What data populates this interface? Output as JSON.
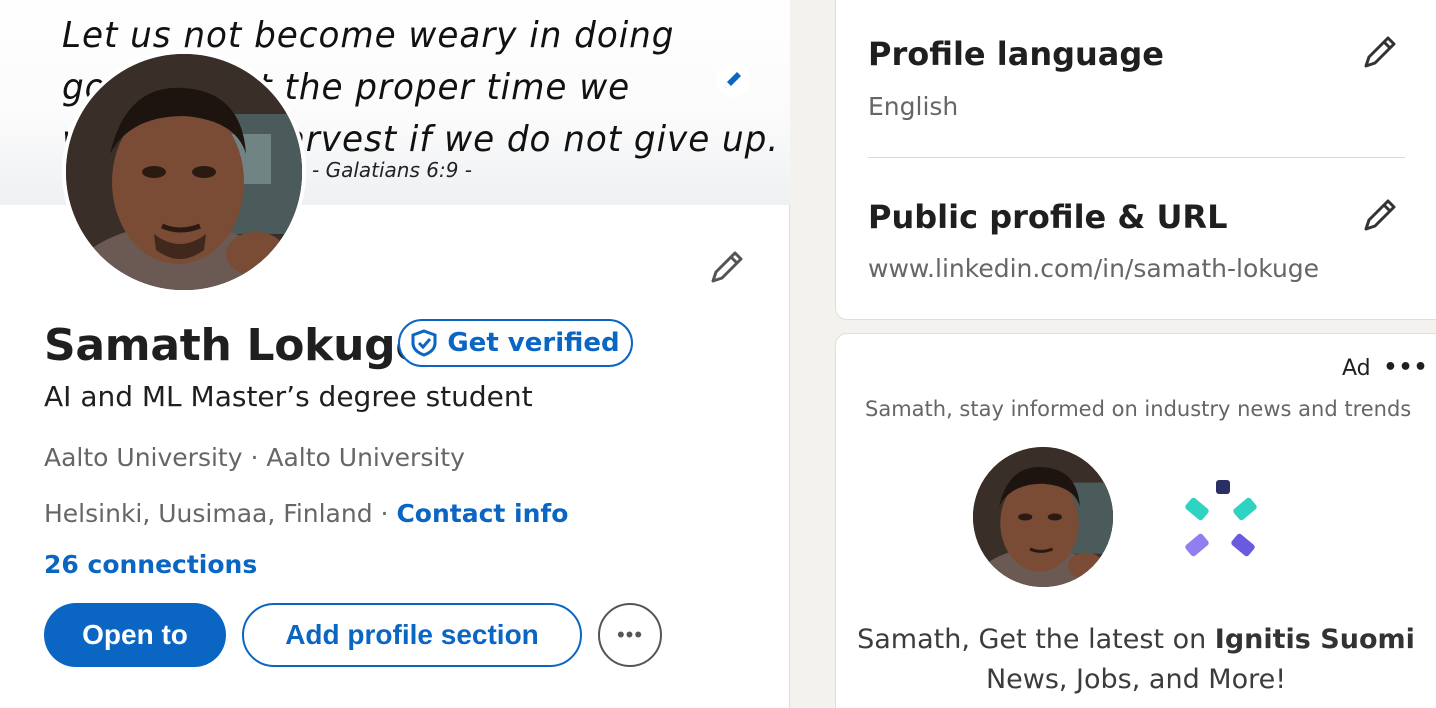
{
  "banner": {
    "quote_lines": [
      "Let us not become weary in doing",
      "good, for at the proper time we",
      "will reap a harvest if we do not give up."
    ],
    "reference": "- Galatians 6:9 -"
  },
  "profile": {
    "name": "Samath Lokuge",
    "verify_label": "Get verified",
    "headline": "AI and ML Master’s degree student",
    "education": "Aalto University · Aalto University",
    "location": "Helsinki, Uusimaa, Finland",
    "separator": " · ",
    "contact_label": "Contact info",
    "connections": "26 connections",
    "actions": {
      "open_to": "Open to",
      "add_section": "Add profile section",
      "more": "•••"
    }
  },
  "settings": {
    "language_title": "Profile language",
    "language_value": "English",
    "public_title": "Public profile & URL",
    "public_value": "www.linkedin.com/in/samath-lokuge"
  },
  "ad": {
    "label": "Ad",
    "menu": "•••",
    "subtitle": "Samath, stay informed on industry news and trends",
    "text_prefix": "Samath, Get the latest on ",
    "company": "Ignitis Suomi",
    "text_suffix": "News, Jobs, and More!"
  },
  "colors": {
    "brand_blue": "#0a66c2",
    "page_bg": "#f4f2ee",
    "logo_teal": "#2ed3c2",
    "logo_purple": "#8f7ff0",
    "logo_navy": "#2a2f66"
  },
  "icons": {
    "edit": "pencil-icon",
    "verify": "shield-check-icon",
    "more": "ellipsis-icon"
  }
}
